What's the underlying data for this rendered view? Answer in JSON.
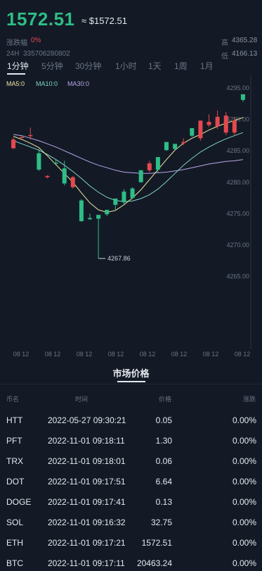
{
  "header": {
    "price": "1572.51",
    "approx": "≈ $1572.51",
    "change_label": "涨跌幅",
    "change_value": "0%",
    "volume_label": "24H",
    "volume_value": "335706280802",
    "high_label": "高",
    "high_value": "4365.28",
    "low_label": "低",
    "low_value": "4166.13"
  },
  "tabs": [
    {
      "label": "1分钟",
      "active": true
    },
    {
      "label": "5分钟",
      "active": false
    },
    {
      "label": "30分钟",
      "active": false
    },
    {
      "label": "1小时",
      "active": false
    },
    {
      "label": "1天",
      "active": false
    },
    {
      "label": "1周",
      "active": false
    },
    {
      "label": "1月",
      "active": false
    }
  ],
  "indicators": {
    "ma5": "MA5:0",
    "ma10": "MA10:0",
    "ma30": "MA30:0"
  },
  "colors": {
    "up": "#2ebd85",
    "down": "#e5484d",
    "ma5": "#f0e6a0",
    "ma10": "#7fd3c6",
    "ma30": "#b9a6e8"
  },
  "chart_data": {
    "type": "candlestick",
    "y_ticks": [
      "4295.00",
      "4290.00",
      "4285.00",
      "4280.00",
      "4275.00",
      "4270.00",
      "4265.00"
    ],
    "ylim": [
      4263.5,
      4296
    ],
    "x_ticks": [
      "08 12",
      "08 12",
      "08 12",
      "08 12",
      "08 12",
      "08 12",
      "08 12",
      "08 12"
    ],
    "min_label": "4267.86",
    "candles": [
      {
        "o": 4286.8,
        "h": 4287.1,
        "c": 4285.4,
        "l": 4285.3
      },
      {
        "o": 4287.2,
        "h": 4287.3,
        "c": 4287.1,
        "l": 4287.0
      },
      {
        "o": 4287.5,
        "h": 4288.7,
        "c": 4287.4,
        "l": 4286.8
      },
      {
        "o": 4282.0,
        "h": 4285.3,
        "c": 4284.6,
        "l": 4281.8
      },
      {
        "o": 4281.0,
        "h": 4281.1,
        "c": 4280.8,
        "l": 4280.6
      },
      {
        "o": 4283.0,
        "h": 4283.6,
        "c": 4283.1,
        "l": 4282.9
      },
      {
        "o": 4279.8,
        "h": 4283.4,
        "c": 4282.2,
        "l": 4279.5
      },
      {
        "o": 4280.8,
        "h": 4281.0,
        "c": 4279.2,
        "l": 4279.0
      },
      {
        "o": 4273.8,
        "h": 4277.3,
        "c": 4277.1,
        "l": 4273.7
      },
      {
        "o": 4274.1,
        "h": 4275.0,
        "c": 4274.3,
        "l": 4274.0
      },
      {
        "o": 4274.2,
        "h": 4274.6,
        "c": 4274.8,
        "l": 4267.86
      },
      {
        "o": 4274.9,
        "h": 4275.5,
        "c": 4275.6,
        "l": 4274.6
      },
      {
        "o": 4276.4,
        "h": 4276.9,
        "c": 4277.4,
        "l": 4275.5
      },
      {
        "o": 4276.8,
        "h": 4278.9,
        "c": 4278.5,
        "l": 4276.5
      },
      {
        "o": 4277.5,
        "h": 4279.2,
        "c": 4279.0,
        "l": 4277.3
      },
      {
        "o": 4280.0,
        "h": 4281.7,
        "c": 4281.9,
        "l": 4279.9
      },
      {
        "o": 4283.0,
        "h": 4283.4,
        "c": 4281.9,
        "l": 4281.6
      },
      {
        "o": 4282.0,
        "h": 4282.4,
        "c": 4284.0,
        "l": 4281.5
      },
      {
        "o": 4285.1,
        "h": 4285.3,
        "c": 4286.4,
        "l": 4285.0
      },
      {
        "o": 4285.3,
        "h": 4285.5,
        "c": 4286.1,
        "l": 4285.1
      },
      {
        "o": 4286.4,
        "h": 4287.0,
        "c": 4286.2,
        "l": 4285.9
      },
      {
        "o": 4287.4,
        "h": 4288.4,
        "c": 4288.6,
        "l": 4287.2
      },
      {
        "o": 4289.8,
        "h": 4289.8,
        "c": 4287.0,
        "l": 4286.6
      },
      {
        "o": 4289.6,
        "h": 4290.8,
        "c": 4289.1,
        "l": 4288.8
      },
      {
        "o": 4290.4,
        "h": 4291.4,
        "c": 4288.9,
        "l": 4288.5
      },
      {
        "o": 4290.6,
        "h": 4291.2,
        "c": 4287.9,
        "l": 4287.5
      },
      {
        "o": 4289.8,
        "h": 4290.4,
        "c": 4287.9,
        "l": 4287.4
      },
      {
        "o": 4293.1,
        "h": 4294.0,
        "c": 4294.0,
        "l": 4292.8
      }
    ],
    "ma5": [
      4287.3,
      4286.8,
      4286.2,
      4285.5,
      4284.2,
      4282.8,
      4281.4,
      4280.0,
      4278.3,
      4276.7,
      4275.6,
      4275.2,
      4275.5,
      4276.4,
      4277.5,
      4278.8,
      4280.4,
      4282.0,
      4283.6,
      4285.1,
      4286.2,
      4287.0,
      4287.6,
      4288.3,
      4288.9,
      4289.4,
      4289.8,
      4290.3
    ],
    "ma10": [
      4286.6,
      4286.1,
      4285.6,
      4285.1,
      4284.4,
      4283.6,
      4282.7,
      4281.7,
      4280.6,
      4279.4,
      4278.4,
      4277.6,
      4277.1,
      4276.9,
      4277.0,
      4277.4,
      4278.0,
      4278.9,
      4280.1,
      4281.4,
      4282.7,
      4283.8,
      4284.8,
      4285.6,
      4286.3,
      4286.9,
      4287.4,
      4287.9
    ],
    "ma30": [
      4287.6,
      4287.4,
      4287.0,
      4286.6,
      4286.1,
      4285.6,
      4285.0,
      4284.4,
      4283.8,
      4283.2,
      4282.7,
      4282.3,
      4281.9,
      4281.6,
      4281.5,
      4281.4,
      4281.4,
      4281.5,
      4281.6,
      4281.8,
      4282.0,
      4282.3,
      4282.6,
      4282.9,
      4283.1,
      4283.3,
      4283.4,
      4283.6
    ]
  },
  "market": {
    "title": "市场价格",
    "headers": {
      "name": "币名",
      "time": "时间",
      "price": "价格",
      "change": "涨跌"
    },
    "rows": [
      {
        "name": "HTT",
        "time": "2022-05-27 09:30:21",
        "price": "0.05",
        "change": "0.00%"
      },
      {
        "name": "PFT",
        "time": "2022-11-01 09:18:11",
        "price": "1.30",
        "change": "0.00%"
      },
      {
        "name": "TRX",
        "time": "2022-11-01 09:18:01",
        "price": "0.06",
        "change": "0.00%"
      },
      {
        "name": "DOT",
        "time": "2022-11-01 09:17:51",
        "price": "6.64",
        "change": "0.00%"
      },
      {
        "name": "DOGE",
        "time": "2022-11-01 09:17:41",
        "price": "0.13",
        "change": "0.00%"
      },
      {
        "name": "SOL",
        "time": "2022-11-01 09:16:32",
        "price": "32.75",
        "change": "0.00%"
      },
      {
        "name": "ETH",
        "time": "2022-11-01 09:17:21",
        "price": "1572.51",
        "change": "0.00%"
      },
      {
        "name": "BTC",
        "time": "2022-11-01 09:17:11",
        "price": "20463.24",
        "change": "0.00%"
      }
    ]
  }
}
